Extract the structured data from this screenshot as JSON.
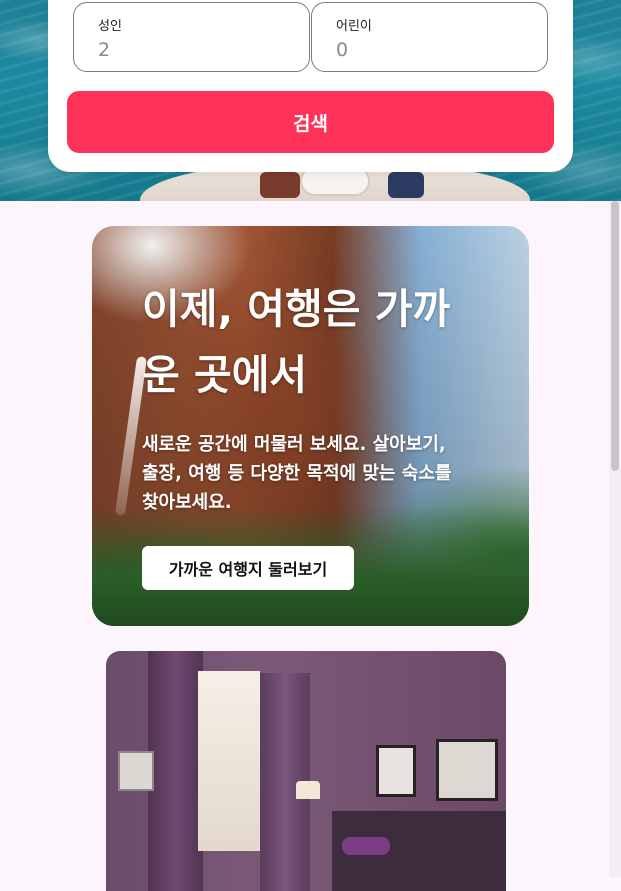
{
  "search": {
    "adults": {
      "label": "성인",
      "value": "2"
    },
    "children": {
      "label": "어린이",
      "value": "0"
    },
    "button_label": "검색"
  },
  "promo": {
    "title": "이제, 여행은 가까운 곳에서",
    "description": "새로운 공간에 머물러 보세요. 살아보기, 출장, 여행 등 다양한 목적에 맞는 숙소를 찾아보세요.",
    "button_label": "가까운 여행지 둘러보기"
  },
  "colors": {
    "accent": "#fe3158",
    "page_background": "#fcf5fc"
  }
}
